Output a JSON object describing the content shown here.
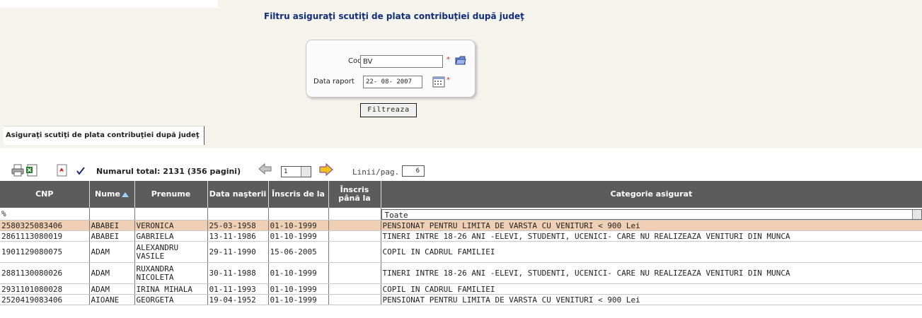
{
  "filter": {
    "title": "Filtru asiguraţi scutiţi de plata contribuţiei după judeţ",
    "cod_label": "Cod judeţ",
    "cod_value": "BV",
    "data_label": "Data raport",
    "data_value": "22- 08- 2007",
    "required_mark": "*",
    "button_label": "Filtreaza"
  },
  "tab": {
    "label": "Asiguraţi scutiţi de plata contribuţiei după judeţ"
  },
  "toolbar": {
    "total_label": "Numarul total: 2131 (356 pagini)",
    "page_value": "1",
    "rows_label": "Linii/pag.",
    "rows_value": "6"
  },
  "table": {
    "headers": [
      "CNP",
      "Nume",
      "Prenume",
      "Data naşterii",
      "Înscris de la",
      "Înscris până la",
      "Categorie asigurat"
    ],
    "filter_row": {
      "cnp": "%",
      "category": "Toate"
    },
    "rows": [
      {
        "cnp": "2580325083406",
        "nume": "ABABEI",
        "prenume": "VERONICA",
        "nastere": "25-03-1958",
        "de_la": "01-10-1999",
        "pana_la": "",
        "categorie": "PENSIONAT PENTRU LIMITA DE VARSTA CU VENITURI < 900 Lei"
      },
      {
        "cnp": "2861113080019",
        "nume": "ABABEI",
        "prenume": "GABRIELA",
        "nastere": "13-11-1986",
        "de_la": "01-10-1999",
        "pana_la": "",
        "categorie": "TINERI INTRE 18-26 ANI -ELEVI, STUDENTI, UCENICI- CARE NU REALIZEAZA VENITURI DIN MUNCA"
      },
      {
        "cnp": "1901129080075",
        "nume": "ADAM",
        "prenume": "ALEXANDRU VASILE",
        "nastere": "29-11-1990",
        "de_la": "15-06-2005",
        "pana_la": "",
        "categorie": "COPIL IN CADRUL FAMILIEI"
      },
      {
        "cnp": "2881130080026",
        "nume": "ADAM",
        "prenume": "RUXANDRA NICOLETA",
        "nastere": "30-11-1988",
        "de_la": "01-10-1999",
        "pana_la": "",
        "categorie": "TINERI INTRE 18-26 ANI -ELEVI, STUDENTI, UCENICI- CARE NU REALIZEAZA VENITURI DIN MUNCA"
      },
      {
        "cnp": "2931101080028",
        "nume": "ADAM",
        "prenume": "IRINA MIHALA",
        "nastere": "01-11-1993",
        "de_la": "01-10-1999",
        "pana_la": "",
        "categorie": "COPIL IN CADRUL FAMILIEI"
      },
      {
        "cnp": "2520419083406",
        "nume": "AIOANE",
        "prenume": "GEORGETA",
        "nastere": "19-04-1952",
        "de_la": "01-10-1999",
        "pana_la": "",
        "categorie": "PENSIONAT PENTRU LIMITA DE VARSTA CU VENITURI < 900 Lei"
      }
    ]
  },
  "colors": {
    "header_bg": "#5c5c5c",
    "selected_row": "#f0d0b5",
    "band_bg": "#f4f4ec",
    "title_blue": "#102c7a"
  },
  "icons": [
    "print-icon",
    "excel-icon",
    "pdf-icon",
    "checkmark-icon",
    "prev-page-icon",
    "next-page-icon",
    "folder-icon",
    "calendar-icon",
    "sort-asc-icon"
  ]
}
